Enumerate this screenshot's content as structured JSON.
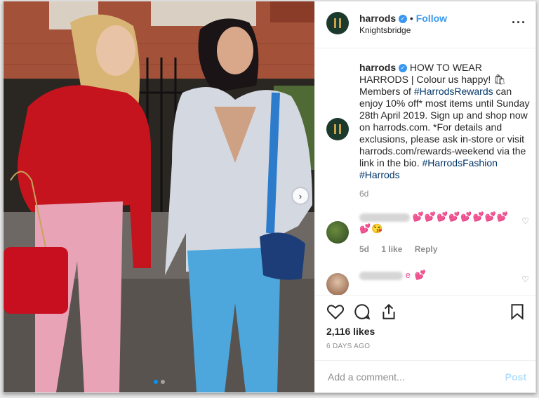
{
  "header": {
    "username": "harrods",
    "separator": "•",
    "follow_label": "Follow",
    "location": "Knightsbridge",
    "more_icon": "more-horizontal-icon"
  },
  "caption": {
    "username": "harrods",
    "part1": "HOW TO WEAR HARRODS | Colour us happy! 🛍 Members of ",
    "tag1": "#HarrodsRewards",
    "part2": " can enjoy 10% off* most items until Sunday 28th April 2019. Sign up and shop now on harrods.com. *For details and exclusions, please ask in-store or visit harrods.com/rewards-weekend via the link in the bio. ",
    "tag2": "#HarrodsFashion",
    "tag3": "#Harrods",
    "time": "6d"
  },
  "comments": [
    {
      "text": "💕💕💕💕💕💕💕💕💕😘",
      "time": "5d",
      "likes": "1 like",
      "reply": "Reply"
    },
    {
      "text": "e 💕"
    }
  ],
  "actions": {
    "likes": "2,116 likes",
    "date": "6 DAYS AGO",
    "comment_placeholder": "Add a comment...",
    "post_label": "Post"
  },
  "colors": {
    "link": "#3897f0",
    "hashtag": "#003569",
    "muted": "#8e8e8e",
    "post_disabled": "#b2dffc"
  }
}
